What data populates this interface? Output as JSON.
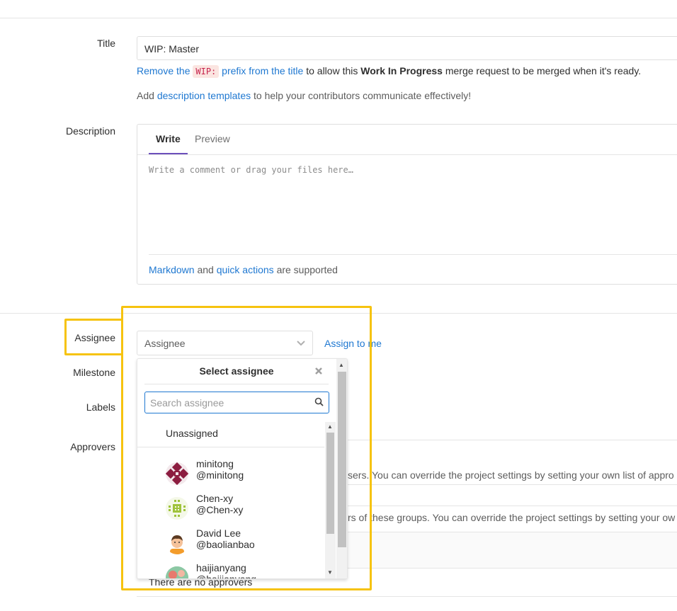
{
  "form": {
    "title_label": "Title",
    "title_value": "WIP: Master",
    "wip_hint": {
      "link1": "Remove the",
      "code": "WIP:",
      "link2": "prefix from the title",
      "text1": "to allow this",
      "bold": "Work In Progress",
      "text2": "merge request to be merged when it's ready."
    },
    "templates_hint": {
      "text1": "Add",
      "link": "description templates",
      "text2": "to help your contributors communicate effectively!"
    },
    "description_label": "Description",
    "tabs": [
      "Write",
      "Preview"
    ],
    "description_placeholder": "Write a comment or drag your files here…",
    "markdown_hint": {
      "link1": "Markdown",
      "text1": "and",
      "link2": "quick actions",
      "text2": "are supported"
    },
    "assignee_label": "Assignee",
    "assignee_select": "Assignee",
    "assign_to_me": "Assign to me",
    "milestone_label": "Milestone",
    "labels_label": "Labels",
    "approvers_label": "Approvers",
    "approvers_text1": "sers. You can override the project settings by setting your own list of appro",
    "approvers_text2": "rs of these groups. You can override the project settings by setting your ow",
    "no_approvers": "There are no approvers"
  },
  "dropdown": {
    "title": "Select assignee",
    "search_placeholder": "Search assignee",
    "unassigned": "Unassigned",
    "users": [
      {
        "name": "minitong",
        "handle": "@minitong",
        "avatar": "pattern-avatar-maroon"
      },
      {
        "name": "Chen-xy",
        "handle": "@Chen-xy",
        "avatar": "pattern-avatar-green"
      },
      {
        "name": "David Lee",
        "handle": "@baolianbao",
        "avatar": "cartoon-person-avatar"
      },
      {
        "name": "haijianyang",
        "handle": "@haijianyang",
        "avatar": "photo-avatar"
      }
    ]
  },
  "colors": {
    "link": "#1f78d1",
    "highlight": "#f6c30f",
    "tab_active": "#6b4fbb"
  }
}
